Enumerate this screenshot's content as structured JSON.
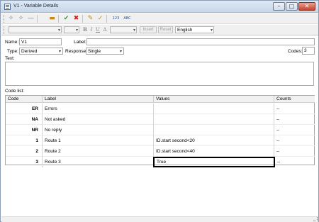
{
  "window": {
    "title": "V1 - Variable Details",
    "buttons": {
      "minimize": "–",
      "maximize": "□",
      "close": "✕"
    }
  },
  "toolbar": {
    "icons": [
      "add-below",
      "add-above",
      "delete-row",
      "open-folder",
      "accept-check",
      "reject-cross",
      "edit-check",
      "edit-spell",
      "numbering",
      "spell-check"
    ],
    "numbering_label": "123",
    "spell_label": "ABC"
  },
  "format_bar": {
    "bold": "B",
    "italic": "I",
    "underline": "U",
    "insert_label": "Insert",
    "reset_label": "Reset",
    "language": "English"
  },
  "form": {
    "name_label": "Name:",
    "name_value": "V1",
    "label_label": "Label:",
    "label_value": "",
    "type_label": "Type:",
    "type_value": "Derived",
    "response_label": "Response:",
    "response_value": "Single",
    "codes_label": "Codes:",
    "codes_value": "3",
    "text_label": "Text:",
    "code_list_label": "Code list:"
  },
  "grid": {
    "headers": {
      "code": "Code",
      "label": "Label",
      "values": "Values",
      "counts": "Counts"
    },
    "rows": [
      {
        "code": "ER",
        "label": "Errors",
        "values": "",
        "counts": "--"
      },
      {
        "code": "NA",
        "label": "Not asked",
        "values": "",
        "counts": "--"
      },
      {
        "code": "NR",
        "label": "No reply",
        "values": "",
        "counts": "--"
      },
      {
        "code": "1",
        "label": "Route 1",
        "values": "ID.start second<20",
        "counts": "--"
      },
      {
        "code": "2",
        "label": "Route 2",
        "values": "ID.start second<40",
        "counts": "--"
      },
      {
        "code": "3",
        "label": "Route 3",
        "values": "True",
        "counts": "--"
      }
    ]
  },
  "colors": {
    "accept": "#2e9a2e",
    "reject": "#d12020",
    "title_bg": "#c6d6ea"
  }
}
